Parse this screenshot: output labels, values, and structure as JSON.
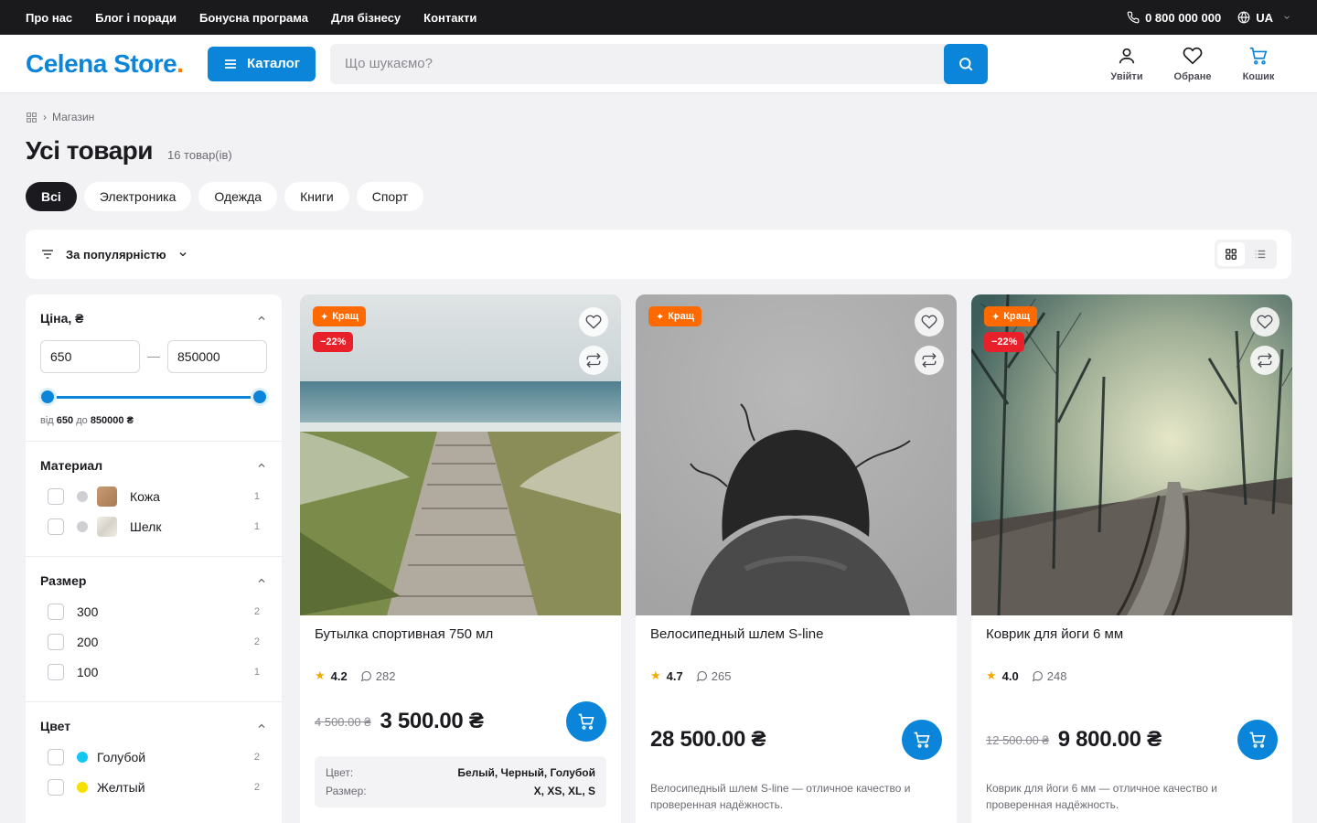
{
  "topbar": {
    "links": [
      "Про нас",
      "Блог і поради",
      "Бонусна програма",
      "Для бізнесу",
      "Контакти"
    ],
    "phone": "0 800 000 000",
    "lang": "UA"
  },
  "header": {
    "logo": "Celena Store",
    "logo_dot": ".",
    "catalog_label": "Каталог",
    "search_placeholder": "Що шукаємо?",
    "actions": [
      {
        "label": "Увійти",
        "icon": "user-icon"
      },
      {
        "label": "Обране",
        "icon": "heart-icon"
      },
      {
        "label": "Кошик",
        "icon": "cart-icon"
      }
    ]
  },
  "breadcrumb": {
    "current": "Магазин"
  },
  "page": {
    "title": "Усі товари",
    "count": "16 товар(ів)"
  },
  "chips": [
    "Всі",
    "Электроника",
    "Одежда",
    "Книги",
    "Спорт"
  ],
  "sort": {
    "label": "За популярністю"
  },
  "filters": {
    "price": {
      "title": "Ціна, ₴",
      "min": "650",
      "max": "850000",
      "range_from_label": "від",
      "range_from": "650",
      "range_to_label": "до",
      "range_to": "850000 ₴"
    },
    "material": {
      "title": "Материал",
      "options": [
        {
          "label": "Кожа",
          "count": "1"
        },
        {
          "label": "Шелк",
          "count": "1"
        }
      ]
    },
    "size": {
      "title": "Размер",
      "options": [
        {
          "label": "300",
          "count": "2"
        },
        {
          "label": "200",
          "count": "2"
        },
        {
          "label": "100",
          "count": "1"
        }
      ]
    },
    "color": {
      "title": "Цвет",
      "options": [
        {
          "label": "Голубой",
          "count": "2",
          "color": "#12c7f2"
        },
        {
          "label": "Желтый",
          "count": "2",
          "color": "#f5e000"
        }
      ]
    }
  },
  "products": [
    {
      "name": "Бутылка спортивная 750 мл",
      "badge_best": "Кращ",
      "badge_discount": "−22%",
      "rating": "4.2",
      "reviews": "282",
      "old_price": "4 500.00 ₴",
      "price": "3 500.00 ₴",
      "attrs": [
        {
          "key": "Цвет:",
          "value": "Белый, Черный, Голубой"
        },
        {
          "key": "Размер:",
          "value": "X, XS, XL, S"
        }
      ]
    },
    {
      "name": "Велосипедный шлем S-line",
      "badge_best": "Кращ",
      "rating": "4.7",
      "reviews": "265",
      "price": "28 500.00 ₴",
      "description": "Велосипедный шлем S-line — отличное качество и проверенная надёжность."
    },
    {
      "name": "Коврик для йоги 6 мм",
      "badge_best": "Кращ",
      "badge_discount": "−22%",
      "rating": "4.0",
      "reviews": "248",
      "old_price": "12 500.00 ₴",
      "price": "9 800.00 ₴",
      "description": "Коврик для йоги 6 мм — отличное качество и проверенная надёжность."
    }
  ],
  "colors": {
    "accent": "#0a85d9",
    "badge_best": "#ff6a00",
    "badge_discount": "#e8202a",
    "topbar": "#1a1a1d"
  }
}
